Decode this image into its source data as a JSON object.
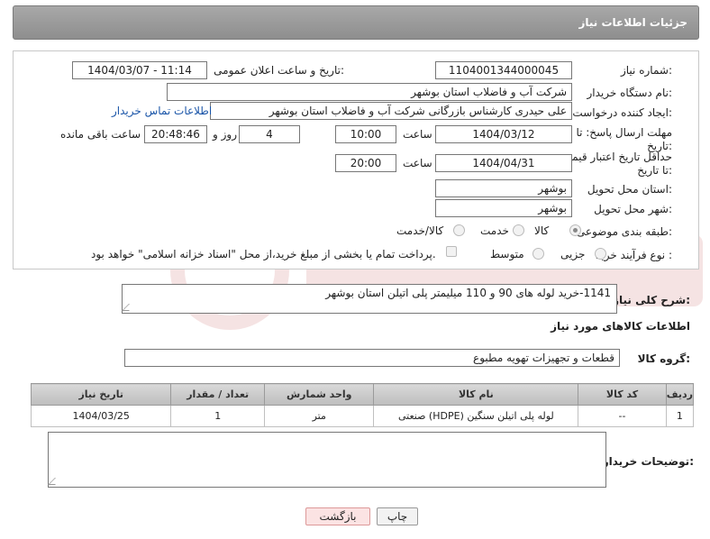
{
  "header": {
    "title": "جزئیات اطلاعات نیاز"
  },
  "form": {
    "need_number": {
      "label": "شماره نیاز:",
      "value": "1104001344000045"
    },
    "public_date": {
      "label": "تاریخ و ساعت اعلان عمومی:",
      "value": "1404/03/07 - 11:14"
    },
    "buyer_org": {
      "label": "نام دستگاه خریدار:",
      "value": "شرکت آب و فاضلاب استان بوشهر"
    },
    "requester": {
      "label": "ایجاد کننده درخواست:",
      "value": "علی حیدری کارشناس بازرگانی شرکت آب و فاضلاب استان بوشهر",
      "link": "اطلاعات تماس خریدار"
    },
    "reply_deadline": {
      "label": "مهلت ارسال پاسخ: تا تاریخ:",
      "date": "1404/03/12",
      "time_label": "ساعت",
      "time": "10:00",
      "days": "4",
      "days_label": "روز و",
      "remaining": "20:48:46",
      "remaining_label": "ساعت باقی مانده"
    },
    "price_validity": {
      "label": "حداقل تاریخ اعتبار قیمت: تا تاریخ:",
      "date": "1404/04/31",
      "time_label": "ساعت",
      "time": "20:00"
    },
    "delivery_province": {
      "label": "استان محل تحویل:",
      "value": "بوشهر"
    },
    "delivery_city": {
      "label": "شهر محل تحویل:",
      "value": "بوشهر"
    },
    "category": {
      "label": "طبقه بندی موضوعی:",
      "options": [
        "کالا",
        "خدمت",
        "کالا/خدمت"
      ],
      "selected": "کالا"
    },
    "process": {
      "label": "نوع فرآیند خرید :",
      "options": [
        "جزیی",
        "متوسط"
      ],
      "note": "پرداخت تمام یا بخشی از مبلغ خرید،از محل \"اسناد خزانه اسلامی\" خواهد بود."
    }
  },
  "description": {
    "label": "شرح کلی نیاز:",
    "value": "1141-خرید لوله های 90 و 110 میلیمتر پلی اتیلن استان بوشهر"
  },
  "goods_section": {
    "title": "اطلاعات کالاهای مورد نیاز",
    "group_label": "گروه کالا:",
    "group_value": "قطعات و تجهیزات تهویه مطبوع"
  },
  "table": {
    "headers": [
      "ردیف",
      "کد کالا",
      "نام کالا",
      "واحد شمارش",
      "تعداد / مقدار",
      "تاریخ نیاز"
    ],
    "rows": [
      [
        "1",
        "--",
        "لوله پلی اتیلن سنگین (HDPE) صنعتی",
        "متر",
        "1",
        "1404/03/25"
      ]
    ]
  },
  "buyer_notes": {
    "label": "توضیحات خریدار:",
    "value": ""
  },
  "buttons": {
    "print": "چاپ",
    "back": "بازگشت"
  },
  "colors": {
    "header_bg": "#999999",
    "link": "#1a55a8",
    "back_button_bg": "#fbe3e3"
  }
}
